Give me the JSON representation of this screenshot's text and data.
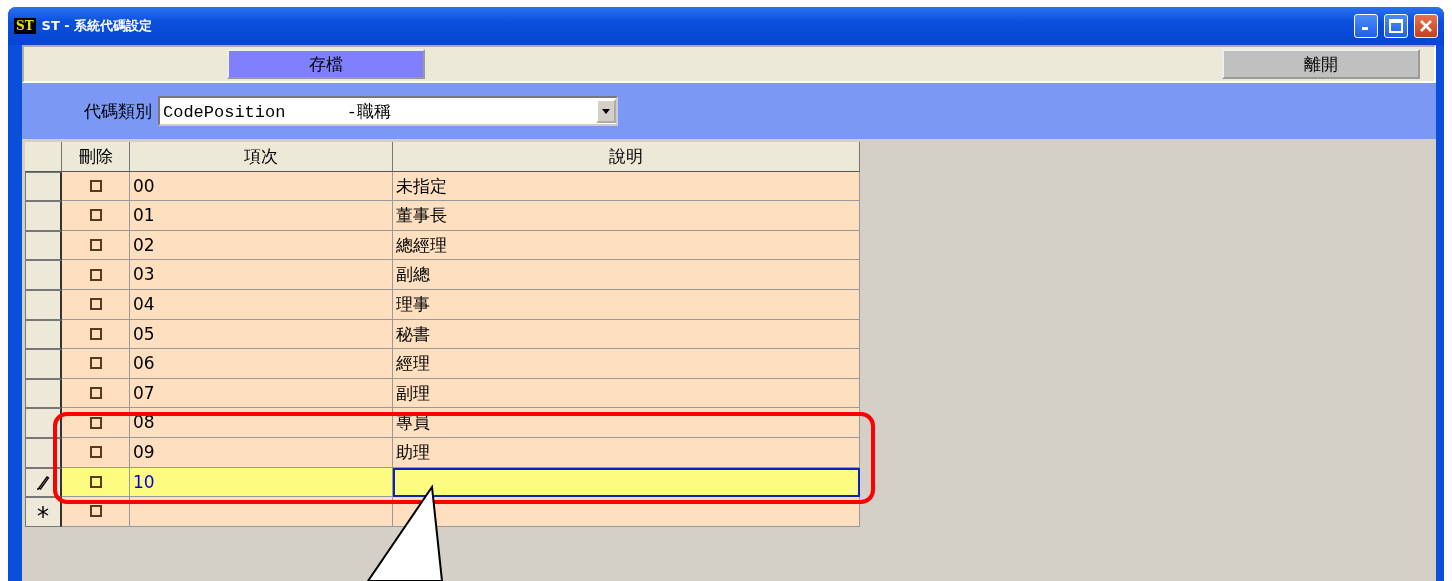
{
  "window": {
    "title": "ST - 系統代碼設定",
    "app_badge": "ST"
  },
  "toolbar": {
    "buttons": [
      {
        "label": "存檔",
        "kind": "primary"
      },
      {
        "label": "離開",
        "kind": "secondary"
      }
    ]
  },
  "filter": {
    "label": "代碼類別",
    "value": "CodePosition      -職稱"
  },
  "table": {
    "columns": [
      "刪除",
      "項次",
      "說明"
    ],
    "rows": [
      {
        "kind": "record",
        "checked": false,
        "code": "00",
        "description": "未指定"
      },
      {
        "kind": "record",
        "checked": false,
        "code": "01",
        "description": "董事長"
      },
      {
        "kind": "record",
        "checked": false,
        "code": "02",
        "description": "總經理"
      },
      {
        "kind": "record",
        "checked": false,
        "code": "03",
        "description": "副總"
      },
      {
        "kind": "record",
        "checked": false,
        "code": "04",
        "description": "理事"
      },
      {
        "kind": "record",
        "checked": false,
        "code": "05",
        "description": "秘書"
      },
      {
        "kind": "record",
        "checked": false,
        "code": "06",
        "description": "經理"
      },
      {
        "kind": "record",
        "checked": false,
        "code": "07",
        "description": "副理"
      },
      {
        "kind": "record",
        "checked": false,
        "code": "08",
        "description": "專員"
      },
      {
        "kind": "record",
        "checked": false,
        "code": "09",
        "description": "助理"
      },
      {
        "kind": "editing",
        "checked": false,
        "code": "10"
      },
      {
        "kind": "new",
        "checked": false
      }
    ]
  }
}
